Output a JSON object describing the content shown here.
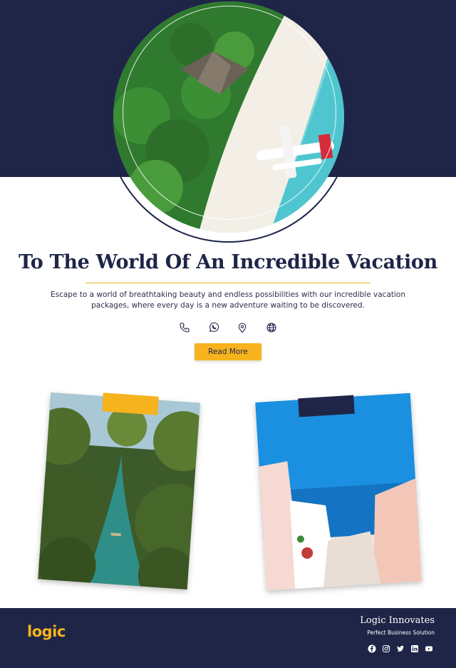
{
  "hero": {
    "title": "To The World Of An Incredible Vacation",
    "description": "Escape to a world of breathtaking beauty and endless possibilities with our incredible vacation packages, where every day is a new adventure waiting to be discovered.",
    "cta_label": "Read More"
  },
  "contact_icons": [
    "phone-icon",
    "whatsapp-icon",
    "location-pin-icon",
    "globe-icon"
  ],
  "colors": {
    "navy": "#1f2547",
    "accent": "#f6b31d",
    "rule": "#e9b72a"
  },
  "footer": {
    "logo_text": "logic",
    "brand_name": "Logic Innovates",
    "tagline": "Perfect Business Solution",
    "social_icons": [
      "facebook-icon",
      "instagram-icon",
      "twitter-icon",
      "linkedin-icon",
      "youtube-icon"
    ]
  }
}
